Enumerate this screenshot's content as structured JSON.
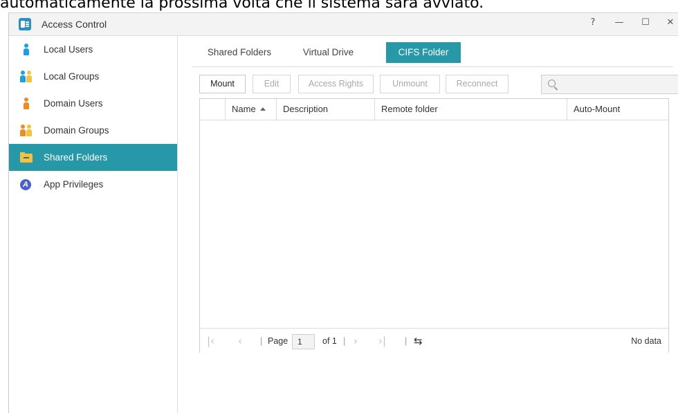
{
  "background_caption": "automaticamente la prossima volta che il sistema sarà avviato.",
  "window": {
    "title": "Access Control",
    "controls": {
      "help": "?",
      "minimize": "—",
      "maximize": "☐",
      "close": "✕"
    }
  },
  "sidebar": {
    "items": [
      {
        "label": "Local Users",
        "icon": "local-user-icon",
        "color": "#1aa0e8",
        "active": false
      },
      {
        "label": "Local Groups",
        "icon": "local-groups-icon",
        "color": "#1aa0e8",
        "active": false
      },
      {
        "label": "Domain Users",
        "icon": "domain-user-icon",
        "color": "#f08c1e",
        "active": false
      },
      {
        "label": "Domain Groups",
        "icon": "domain-groups-icon",
        "color": "#f08c1e",
        "active": false
      },
      {
        "label": "Shared Folders",
        "icon": "folder-icon",
        "color": "#f6c23e",
        "active": true
      },
      {
        "label": "App Privileges",
        "icon": "app-privileges-icon",
        "color": "#4b5fd1",
        "active": false
      }
    ]
  },
  "tabs": [
    {
      "label": "Shared Folders",
      "active": false
    },
    {
      "label": "Virtual Drive",
      "active": false
    },
    {
      "label": "CIFS Folder",
      "active": true
    }
  ],
  "toolbar": {
    "mount": "Mount",
    "edit": "Edit",
    "access_rights": "Access Rights",
    "unmount": "Unmount",
    "reconnect": "Reconnect",
    "search_placeholder": ""
  },
  "table": {
    "columns": [
      "Name",
      "Description",
      "Remote folder",
      "Auto-Mount"
    ],
    "sorted_column": "Name",
    "rows": []
  },
  "pager": {
    "page_label": "Page",
    "current_page": "1",
    "of_label": "of 1",
    "status": "No data"
  },
  "colors": {
    "accent": "#2698a8",
    "folder": "#f6c23e"
  }
}
